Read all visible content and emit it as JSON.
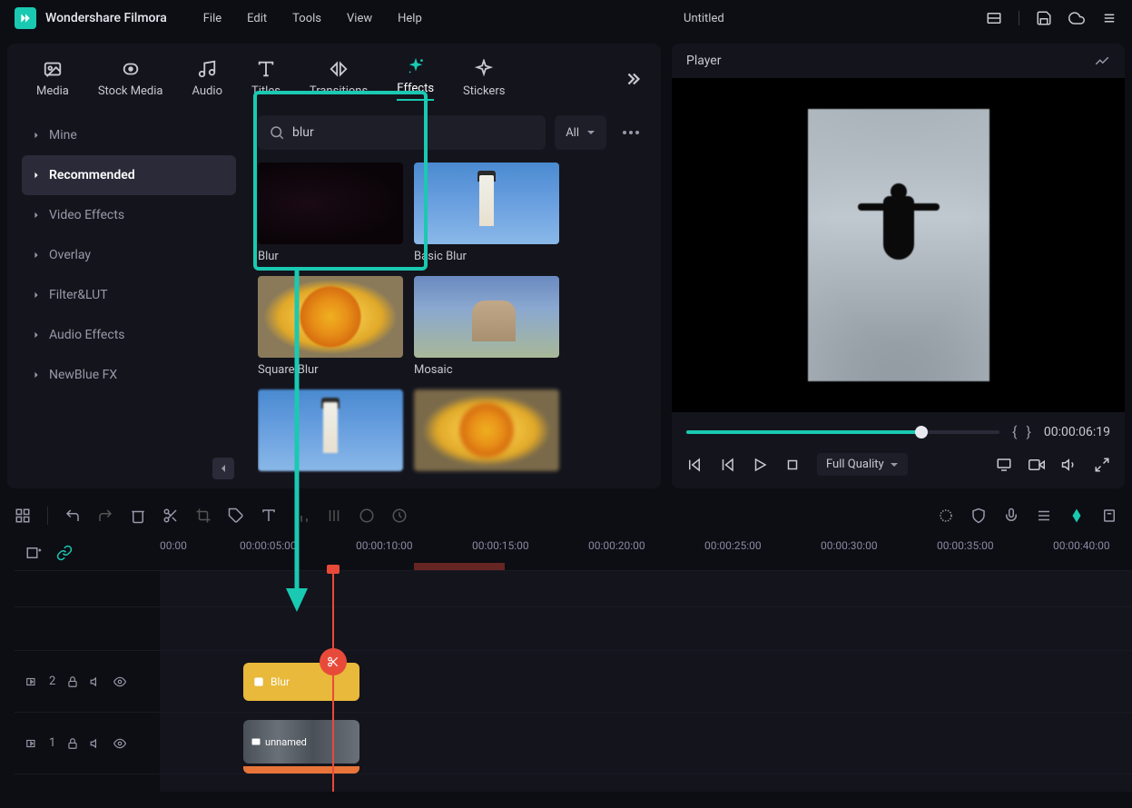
{
  "app": {
    "name": "Wondershare Filmora",
    "title": "Untitled"
  },
  "menu": {
    "file": "File",
    "edit": "Edit",
    "tools": "Tools",
    "view": "View",
    "help": "Help"
  },
  "tabs": {
    "media": "Media",
    "stock": "Stock Media",
    "audio": "Audio",
    "titles": "Titles",
    "transitions": "Transitions",
    "effects": "Effects",
    "stickers": "Stickers"
  },
  "sidebar": {
    "items": [
      {
        "label": "Mine"
      },
      {
        "label": "Recommended"
      },
      {
        "label": "Video Effects"
      },
      {
        "label": "Overlay"
      },
      {
        "label": "Filter&LUT"
      },
      {
        "label": "Audio Effects"
      },
      {
        "label": "NewBlue FX"
      }
    ]
  },
  "search": {
    "value": "blur",
    "placeholder": ""
  },
  "filter": {
    "label": "All"
  },
  "cards": [
    {
      "label": "Blur"
    },
    {
      "label": "Basic Blur"
    },
    {
      "label": "Square Blur"
    },
    {
      "label": "Mosaic"
    },
    {
      "label": ""
    },
    {
      "label": ""
    }
  ],
  "player": {
    "title": "Player",
    "timecode": "00:00:06:19",
    "quality": "Full Quality",
    "bracket_open": "{",
    "bracket_close": "}"
  },
  "timeline": {
    "marks": [
      "00:00",
      "00:00:05:00",
      "00:00:10:00",
      "00:00:15:00",
      "00:00:20:00",
      "00:00:25:00",
      "00:00:30:00",
      "00:00:35:00",
      "00:00:40:00"
    ],
    "track2": {
      "num": "2",
      "clip_label": "Blur"
    },
    "track1": {
      "num": "1",
      "clip_label": "unnamed"
    }
  }
}
